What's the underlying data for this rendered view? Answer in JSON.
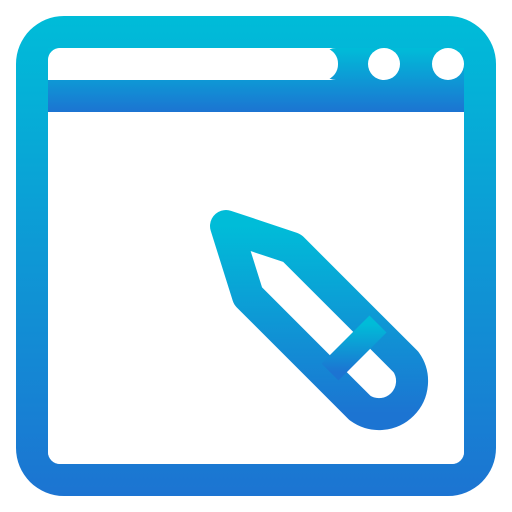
{
  "icon": {
    "name": "browser-window-edit-icon",
    "parts": {
      "window": "browser-window-icon",
      "pencil": "pencil-icon",
      "dots": "window-control-dots-icon"
    },
    "colors": {
      "gradient_top": "#00BCD8",
      "gradient_bottom": "#1C74D2",
      "background": "#FFFFFF"
    }
  }
}
